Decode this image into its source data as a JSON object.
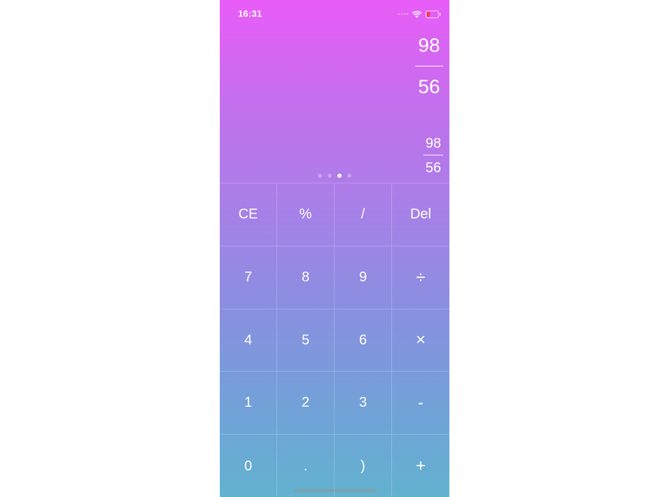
{
  "status_bar": {
    "time": "16:31",
    "icons": [
      "cellular-signal-icon",
      "wifi-icon",
      "battery-low-icon"
    ],
    "battery_color": "#ff3b30"
  },
  "display": {
    "main_fraction": {
      "numerator": "98",
      "denominator": "56"
    },
    "secondary_fraction": {
      "numerator": "98",
      "denominator": "56"
    }
  },
  "pager": {
    "count": 4,
    "active_index": 2
  },
  "keypad": {
    "rows": [
      [
        "CE",
        "%",
        "/",
        "Del"
      ],
      [
        "7",
        "8",
        "9",
        "÷"
      ],
      [
        "4",
        "5",
        "6",
        "×"
      ],
      [
        "1",
        "2",
        "3",
        "-"
      ],
      [
        "0",
        ".",
        ")",
        "+"
      ]
    ]
  },
  "theme": {
    "gradient_top": "#e95cf8",
    "gradient_bottom": "#62b2d0"
  }
}
